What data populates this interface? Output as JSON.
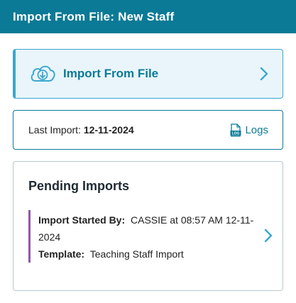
{
  "header": {
    "title": "Import From File: New Staff"
  },
  "import_card": {
    "label": "Import From File",
    "icon": "cloud-download-icon"
  },
  "last_import": {
    "label": "Last Import:",
    "date": "12-11-2024",
    "logs_label": "Logs",
    "logs_icon_text": "LOG"
  },
  "pending": {
    "title": "Pending Imports",
    "items": [
      {
        "started_by_label": "Import Started By:",
        "started_by_value": "CASSIE at 08:57 AM 12-11-2024",
        "template_label": "Template:",
        "template_value": "Teaching Staff Import"
      }
    ]
  },
  "colors": {
    "header_bg": "#0b7a96",
    "accent": "#3aa7cf",
    "item_bar": "#8e5aa6"
  }
}
